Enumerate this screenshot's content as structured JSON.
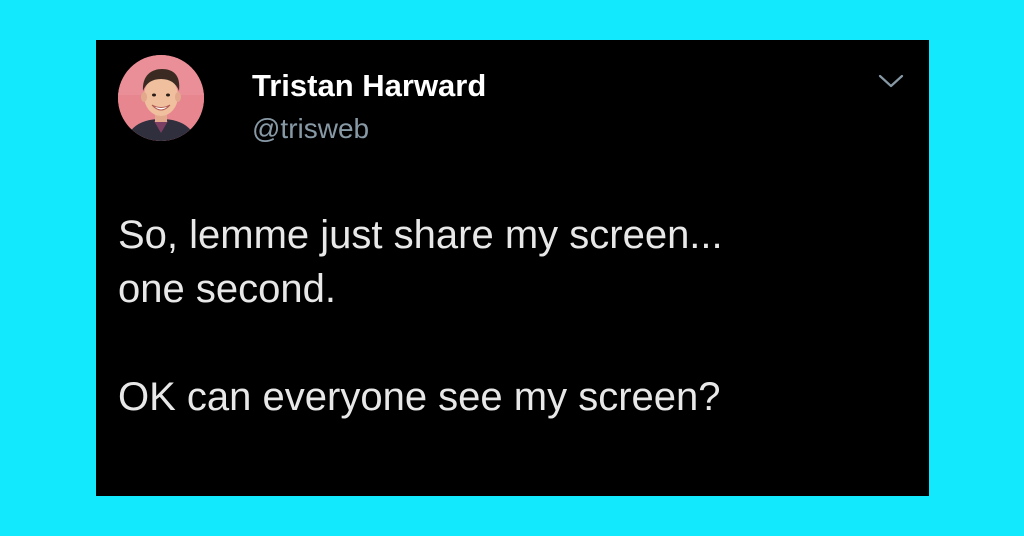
{
  "background_color": "#12e9fd",
  "card_color": "#000000",
  "tweet": {
    "author": {
      "display_name": "Tristan Harward",
      "handle": "@trisweb",
      "avatar": "profile-photo"
    },
    "menu_icon": "chevron-down-icon",
    "body": {
      "line1": "So, lemme just share my screen...",
      "line2": "one second.",
      "line3": "OK can everyone see my screen?"
    }
  }
}
